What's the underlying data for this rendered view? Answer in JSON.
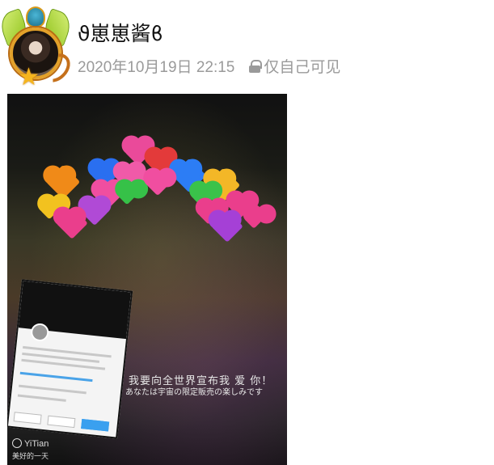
{
  "post": {
    "username": "ϑ崽崽酱ϐ",
    "datetime": "2020年10月19日 22:15",
    "privacy_label": "仅自己可见"
  },
  "photo": {
    "caption_cn": "我要向全世界宣布我 爱 你！",
    "caption_jp": "あなたは宇宙の限定販売の楽しみです",
    "watermark_brand": "YiTian",
    "watermark_sub": "美好的一天"
  }
}
